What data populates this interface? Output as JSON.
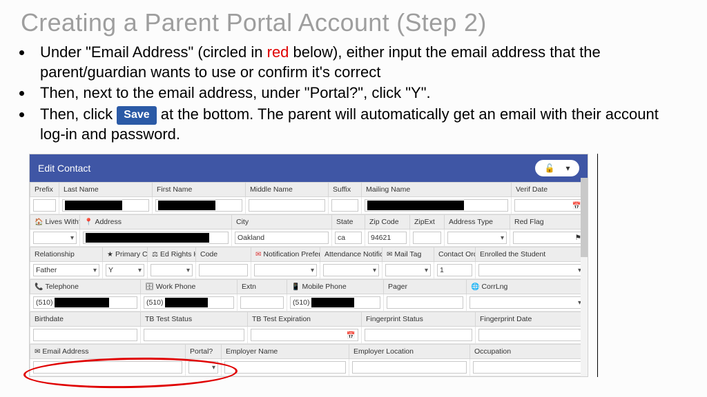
{
  "title": "Creating a Parent Portal Account (Step 2)",
  "bullets": {
    "b1a": "Under \"Email Address\" (circled in ",
    "b1_red": "red",
    "b1b": " below), either input the email address that the parent/guardian wants to use or confirm it's correct",
    "b2": "Then, next to the email address, under \"Portal?\", click \"Y\".",
    "b3a": "Then, click ",
    "b3_save": "Save",
    "b3b": " at the bottom. The parent will automatically get an email with their account log-in and password."
  },
  "form": {
    "header": "Edit Contact",
    "row1": {
      "prefix": "Prefix",
      "lastname": "Last Name",
      "firstname": "First Name",
      "middlename": "Middle Name",
      "suffix": "Suffix",
      "mailingname": "Mailing Name",
      "verifdate": "Verif Date"
    },
    "row2": {
      "liveswith": "Lives With?",
      "address": "Address",
      "city": "City",
      "city_val": "Oakland",
      "state": "State",
      "state_val": "ca",
      "zip": "Zip Code",
      "zip_val": "94621",
      "zipext": "ZipExt",
      "addrtype": "Address Type",
      "redflag": "Red Flag"
    },
    "row3": {
      "relationship": "Relationship",
      "relationship_val": "Father",
      "primary": "Primary Contact",
      "primary_val": "Y",
      "edrights": "Ed Rights Holder?",
      "code": "Code",
      "notif": "Notification Preferences",
      "attnotif": "Attendance Notification",
      "mailtag": "Mail Tag",
      "order": "Contact Order",
      "order_val": "1",
      "enrolled": "Enrolled the Student"
    },
    "row4": {
      "telephone": "Telephone",
      "tel_val": "(510)",
      "workphone": "Work Phone",
      "work_val": "(510)",
      "extn": "Extn",
      "mobile": "Mobile Phone",
      "mobile_val": "(510)",
      "pager": "Pager",
      "corrlng": "CorrLng"
    },
    "row5": {
      "birthdate": "Birthdate",
      "tbstatus": "TB Test Status",
      "tbexp": "TB Test Expiration",
      "fpstatus": "Fingerprint Status",
      "fpdate": "Fingerprint Date"
    },
    "row6": {
      "email": "Email Address",
      "portal": "Portal?",
      "employer": "Employer Name",
      "emploc": "Employer Location",
      "occupation": "Occupation"
    }
  }
}
